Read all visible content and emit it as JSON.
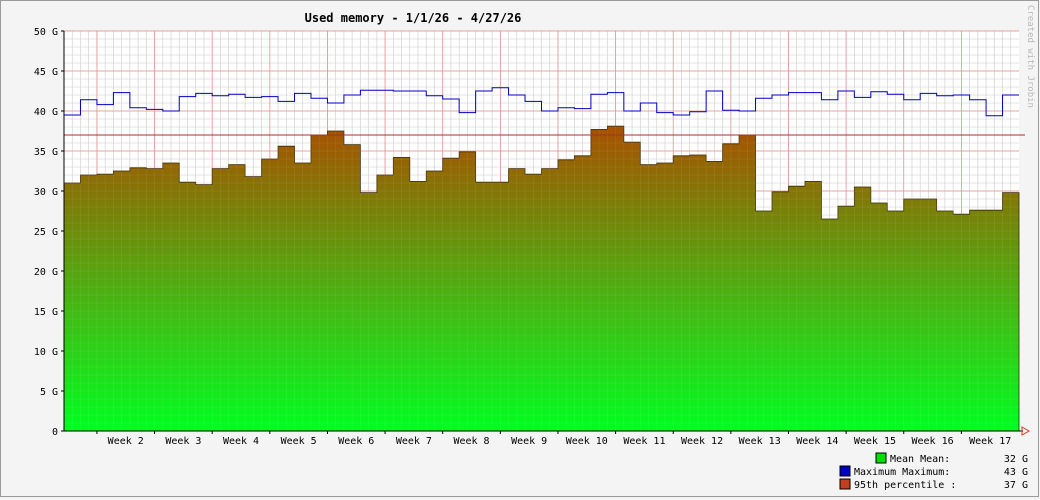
{
  "chart_data": {
    "type": "area",
    "title": "Used memory - 1/1/26 - 4/27/26",
    "watermark": "Created with Jrobin",
    "y_unit": "G",
    "ylim": [
      0,
      50
    ],
    "y_ticks": [
      {
        "value": 0,
        "label": "0"
      },
      {
        "value": 5,
        "label": "5 G"
      },
      {
        "value": 10,
        "label": "10 G"
      },
      {
        "value": 15,
        "label": "15 G"
      },
      {
        "value": 20,
        "label": "20 G"
      },
      {
        "value": 25,
        "label": "25 G"
      },
      {
        "value": 30,
        "label": "30 G"
      },
      {
        "value": 35,
        "label": "35 G"
      },
      {
        "value": 40,
        "label": "40 G"
      },
      {
        "value": 45,
        "label": "45 G"
      },
      {
        "value": 50,
        "label": "50 G"
      }
    ],
    "x_range": [
      "2026-01-01",
      "2026-04-27"
    ],
    "week_ticks": [
      {
        "date": "2026-01-05",
        "label": "Week 2"
      },
      {
        "date": "2026-01-12",
        "label": "Week 3"
      },
      {
        "date": "2026-01-19",
        "label": "Week 4"
      },
      {
        "date": "2026-01-26",
        "label": "Week 5"
      },
      {
        "date": "2026-02-02",
        "label": "Week 6"
      },
      {
        "date": "2026-02-09",
        "label": "Week 7"
      },
      {
        "date": "2026-02-16",
        "label": "Week 8"
      },
      {
        "date": "2026-02-23",
        "label": "Week 9"
      },
      {
        "date": "2026-03-02",
        "label": "Week 10"
      },
      {
        "date": "2026-03-09",
        "label": "Week 11"
      },
      {
        "date": "2026-03-16",
        "label": "Week 12"
      },
      {
        "date": "2026-03-23",
        "label": "Week 13"
      },
      {
        "date": "2026-03-30",
        "label": "Week 14"
      },
      {
        "date": "2026-04-06",
        "label": "Week 15"
      },
      {
        "date": "2026-04-13",
        "label": "Week 16"
      },
      {
        "date": "2026-04-20",
        "label": "Week 17"
      }
    ],
    "step_dates": [
      "2026-01-01",
      "2026-01-03",
      "2026-01-05",
      "2026-01-07",
      "2026-01-09",
      "2026-01-11",
      "2026-01-13",
      "2026-01-15",
      "2026-01-17",
      "2026-01-19",
      "2026-01-21",
      "2026-01-23",
      "2026-01-25",
      "2026-01-27",
      "2026-01-29",
      "2026-01-31",
      "2026-02-02",
      "2026-02-04",
      "2026-02-06",
      "2026-02-08",
      "2026-02-10",
      "2026-02-12",
      "2026-02-14",
      "2026-02-16",
      "2026-02-18",
      "2026-02-20",
      "2026-02-22",
      "2026-02-24",
      "2026-02-26",
      "2026-02-28",
      "2026-03-02",
      "2026-03-04",
      "2026-03-06",
      "2026-03-08",
      "2026-03-10",
      "2026-03-12",
      "2026-03-14",
      "2026-03-16",
      "2026-03-18",
      "2026-03-20",
      "2026-03-22",
      "2026-03-24",
      "2026-03-26",
      "2026-03-28",
      "2026-03-30",
      "2026-04-01",
      "2026-04-03",
      "2026-04-05",
      "2026-04-07",
      "2026-04-09",
      "2026-04-11",
      "2026-04-13",
      "2026-04-15",
      "2026-04-17",
      "2026-04-19",
      "2026-04-21",
      "2026-04-23",
      "2026-04-25",
      "2026-04-27"
    ],
    "series": [
      {
        "name": "Mean",
        "color": "#00e000",
        "values": [
          31.0,
          32.0,
          32.1,
          32.5,
          32.9,
          32.8,
          33.5,
          31.1,
          30.8,
          32.8,
          33.3,
          31.8,
          34.0,
          35.6,
          33.5,
          37.0,
          37.5,
          35.8,
          29.8,
          32.0,
          34.2,
          31.2,
          32.5,
          34.1,
          34.9,
          31.1,
          31.1,
          32.8,
          32.1,
          32.8,
          33.9,
          34.4,
          37.7,
          38.1,
          36.1,
          33.3,
          33.5,
          34.4,
          34.5,
          33.7,
          35.9,
          37.0,
          27.5,
          29.9,
          30.6,
          31.2,
          26.5,
          28.1,
          30.5,
          28.5,
          27.5,
          29.0,
          29.0,
          27.5,
          27.1,
          27.6,
          27.6,
          29.8
        ]
      },
      {
        "name": "Maximum",
        "color": "#0000c0",
        "values": [
          39.5,
          41.4,
          40.8,
          42.3,
          40.4,
          40.2,
          40.0,
          41.8,
          42.2,
          41.9,
          42.1,
          41.7,
          41.8,
          41.2,
          42.2,
          41.6,
          41.0,
          42.0,
          42.6,
          42.6,
          42.5,
          42.5,
          41.9,
          41.5,
          39.8,
          42.5,
          42.9,
          42.0,
          41.2,
          40.0,
          40.4,
          40.3,
          42.1,
          42.3,
          40.0,
          41.0,
          39.8,
          39.5,
          39.9,
          42.5,
          40.1,
          40.0,
          41.6,
          42.0,
          42.3,
          42.3,
          41.4,
          42.5,
          41.7,
          42.4,
          42.1,
          41.4,
          42.2,
          41.9,
          42.0,
          41.4,
          39.4,
          42.0
        ]
      }
    ],
    "percentile_95": {
      "name": "95th percentile",
      "value": 37,
      "color": "#a03030"
    },
    "legend": {
      "placement": "bottom-right",
      "items": [
        {
          "label": "Mean  Mean:",
          "value": "32 G",
          "color": "#00e000"
        },
        {
          "label": "Maximum  Maximum:",
          "value": "43 G",
          "color": "#0000c0"
        },
        {
          "label": "95th percentile  :",
          "value": "37 G",
          "color": "#c04020"
        }
      ]
    },
    "colors": {
      "area_top": "#a85000",
      "area_bottom": "#00ff20",
      "grid_minor": "#c8c8c8",
      "grid_major": "#e08080"
    }
  }
}
